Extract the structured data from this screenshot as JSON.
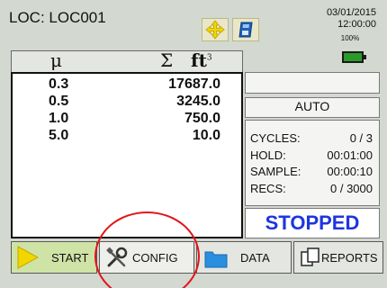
{
  "header": {
    "loc_text": "LOC:  LOC001",
    "date": "03/01/2015",
    "time": "12:00:00",
    "battery_percent": "100%",
    "icons": [
      "move-arrows-icon",
      "save-disk-icon",
      "battery-icon"
    ]
  },
  "table": {
    "col_size_symbol": "μ",
    "col_count_symbol": "Σ",
    "col_unit": "ft",
    "col_unit_sup": "3",
    "rows": [
      {
        "size": "0.3",
        "count": "17687.0"
      },
      {
        "size": "0.5",
        "count": "3245.0"
      },
      {
        "size": "1.0",
        "count": "750.0"
      },
      {
        "size": "5.0",
        "count": "10.0"
      }
    ]
  },
  "side": {
    "mode": "AUTO",
    "stats": [
      {
        "label": "CYCLES:",
        "value": "0 / 3"
      },
      {
        "label": "HOLD:",
        "value": "00:01:00"
      },
      {
        "label": "SAMPLE:",
        "value": "00:00:10"
      },
      {
        "label": "RECS:",
        "value": "0 / 3000"
      }
    ],
    "status": "STOPPED"
  },
  "tabs": {
    "start": "START",
    "config": "CONFIG",
    "data": "DATA",
    "reports": "REPORTS"
  },
  "colors": {
    "status_blue": "#1f35e0",
    "start_icon_yellow": "#f2d600",
    "annotation_red": "#e2141a",
    "battery_green": "#2a9a2a"
  }
}
